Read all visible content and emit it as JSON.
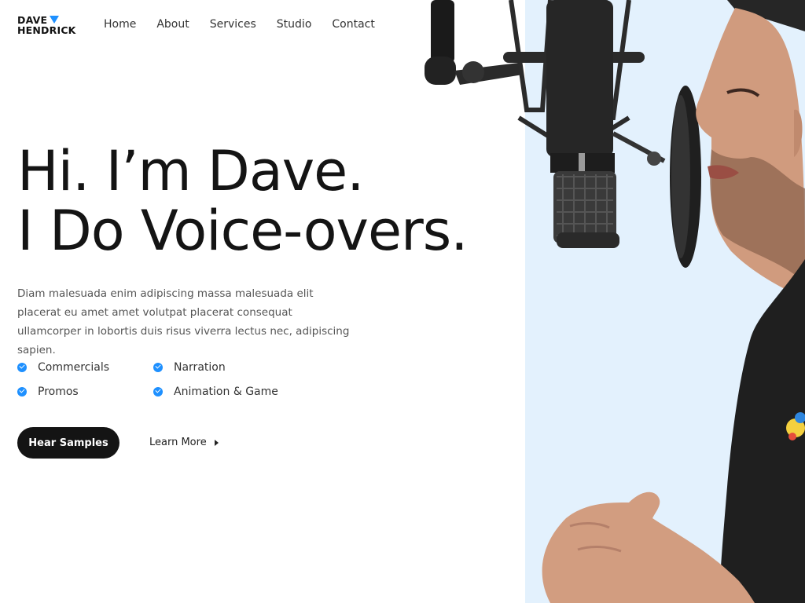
{
  "logo": {
    "line1": "DAVE",
    "line2": "HENDRICK",
    "mark_color": "#1e90ff"
  },
  "nav": {
    "items": [
      "Home",
      "About",
      "Services",
      "Studio",
      "Contact"
    ]
  },
  "hero": {
    "headline_line1": "Hi. I’m Dave.",
    "headline_line2": "I Do Voice-overs.",
    "intro": "Diam malesuada enim adipiscing massa malesuada elit placerat eu amet amet volutpat placerat consequat ullamcorper in lobortis duis risus viverra lectus nec, adipiscing sapien.",
    "features": [
      "Commercials",
      "Narration",
      "Promos",
      "Animation & Game"
    ],
    "primary_button": "Hear Samples",
    "secondary_link": "Learn More",
    "panel_color": "#e3f1fd",
    "accent_color": "#1e90ff"
  }
}
